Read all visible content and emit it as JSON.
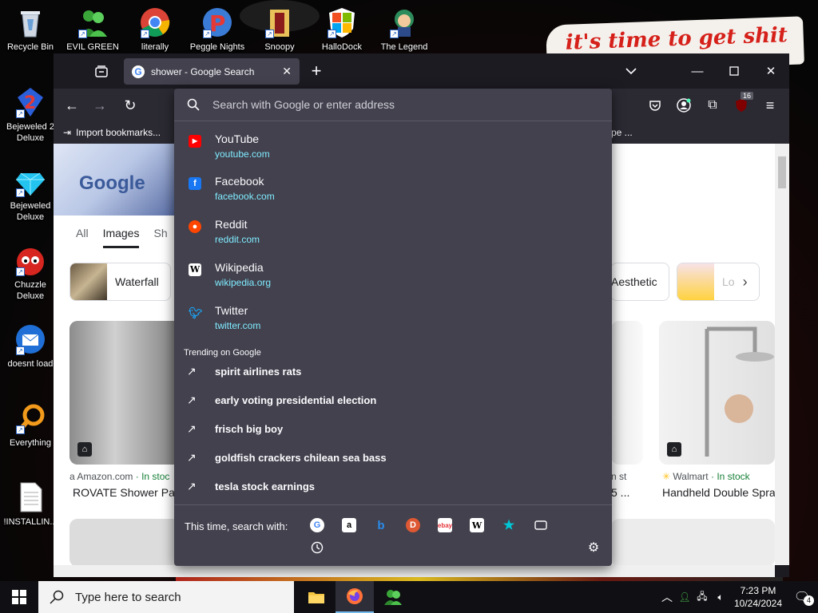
{
  "desktop": {
    "wall_sign_text": "it's time to get shit",
    "icons": [
      {
        "label": "Recycle Bin",
        "icon": "recycle-bin-icon"
      },
      {
        "label": "EVIL GREEN",
        "icon": "green-people-icon"
      },
      {
        "label": "literally",
        "icon": "chrome-icon"
      },
      {
        "label": "Peggle Nights",
        "icon": "peggle-icon"
      },
      {
        "label": "Snoopy",
        "icon": "snoopy-icon"
      },
      {
        "label": "HalloDock",
        "icon": "windows-shield-icon"
      },
      {
        "label": "The Legend",
        "icon": "legend-icon"
      },
      {
        "label": "Bejeweled 2 Deluxe",
        "icon": "bejeweled2-icon"
      },
      {
        "label": "Bejeweled Deluxe",
        "icon": "bejeweled-icon"
      },
      {
        "label": "Chuzzle Deluxe",
        "icon": "chuzzle-icon"
      },
      {
        "label": "doesnt load",
        "icon": "thunderbird-icon"
      },
      {
        "label": "Everything",
        "icon": "everything-icon"
      },
      {
        "label": "!INSTALLIN...",
        "icon": "text-file-icon"
      }
    ]
  },
  "browser": {
    "tab_title": "shower - Google Search",
    "bookmarks": {
      "import": "Import bookmarks...",
      "right_fragment": "pe ..."
    },
    "extension_badge": "16"
  },
  "page": {
    "tabs": [
      "All",
      "Images",
      "Sh"
    ],
    "chips": [
      {
        "label": "Waterfall"
      },
      {
        "label": "Aesthetic"
      },
      {
        "label": "Lo"
      }
    ],
    "results": [
      {
        "source": "Amazon.com",
        "stock": "· In stoc",
        "title": "ROVATE Shower Pa"
      },
      {
        "source": "n st",
        "stock": "",
        "title": "5 ..."
      },
      {
        "source": "Walmart",
        "stock": "· In stock",
        "title": "Handheld Double Spra"
      }
    ]
  },
  "urlbar": {
    "placeholder": "Search with Google or enter address",
    "suggestions": [
      {
        "name": "YouTube",
        "url": "youtube.com",
        "icon": "youtube-icon",
        "color": "#ff0000"
      },
      {
        "name": "Facebook",
        "url": "facebook.com",
        "icon": "facebook-icon",
        "color": "#1877f2"
      },
      {
        "name": "Reddit",
        "url": "reddit.com",
        "icon": "reddit-icon",
        "color": "#ff4500"
      },
      {
        "name": "Wikipedia",
        "url": "wikipedia.org",
        "icon": "wikipedia-icon",
        "color": "#ffffff"
      },
      {
        "name": "Twitter",
        "url": "twitter.com",
        "icon": "twitter-icon",
        "color": "#1da1f2"
      }
    ],
    "trending_heading": "Trending on Google",
    "trending": [
      "spirit airlines rats",
      "early voting presidential election",
      "frisch big boy",
      "goldfish crackers chilean sea bass",
      "tesla stock earnings"
    ],
    "search_with_label": "This time, search with:",
    "engines": [
      "google-icon",
      "amazon-icon",
      "bing-icon",
      "duckduckgo-icon",
      "ebay-icon",
      "wikipedia-icon",
      "bookmarks-star-icon",
      "tabs-icon",
      "history-icon"
    ]
  },
  "taskbar": {
    "search_placeholder": "Type here to search",
    "time": "7:23 PM",
    "date": "10/24/2024",
    "notification_count": "4"
  }
}
